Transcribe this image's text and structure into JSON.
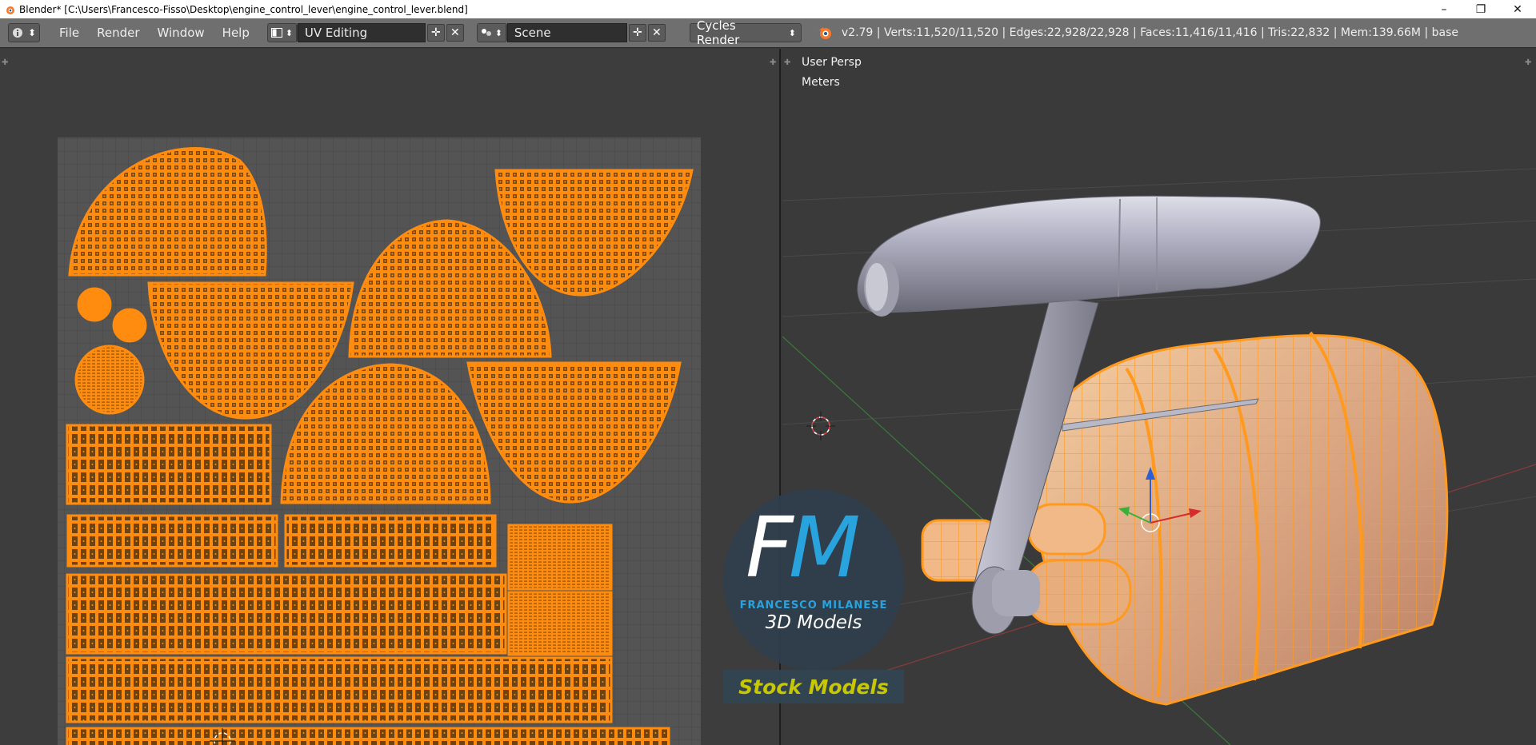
{
  "window": {
    "title": "Blender* [C:\\Users\\Francesco-Fisso\\Desktop\\engine_control_lever\\engine_control_lever.blend]",
    "controls": [
      "–",
      "❐",
      "✕"
    ]
  },
  "infobar": {
    "editor_icon": "info-icon",
    "menus": [
      "File",
      "Render",
      "Window",
      "Help"
    ],
    "screen_layout": "UV Editing",
    "scene": "Scene",
    "render_engine": "Cycles Render",
    "stats": "v2.79 | Verts:11,520/11,520 | Edges:22,928/22,928 | Faces:11,416/11,416 | Tris:22,832 | Mem:139.66M | base"
  },
  "viewport": {
    "view_label": "User Persp",
    "units_label": "Meters"
  },
  "logo": {
    "letters": "FM",
    "name": "FRANCESCO MILANESE",
    "subtitle": "3D Models",
    "banner": "Stock Models"
  },
  "colors": {
    "uv_orange": "#ff8c0f",
    "background": "#393939",
    "header": "#6f6f6f",
    "logo_blue": "#29a3de",
    "banner_text": "#c8c800"
  }
}
